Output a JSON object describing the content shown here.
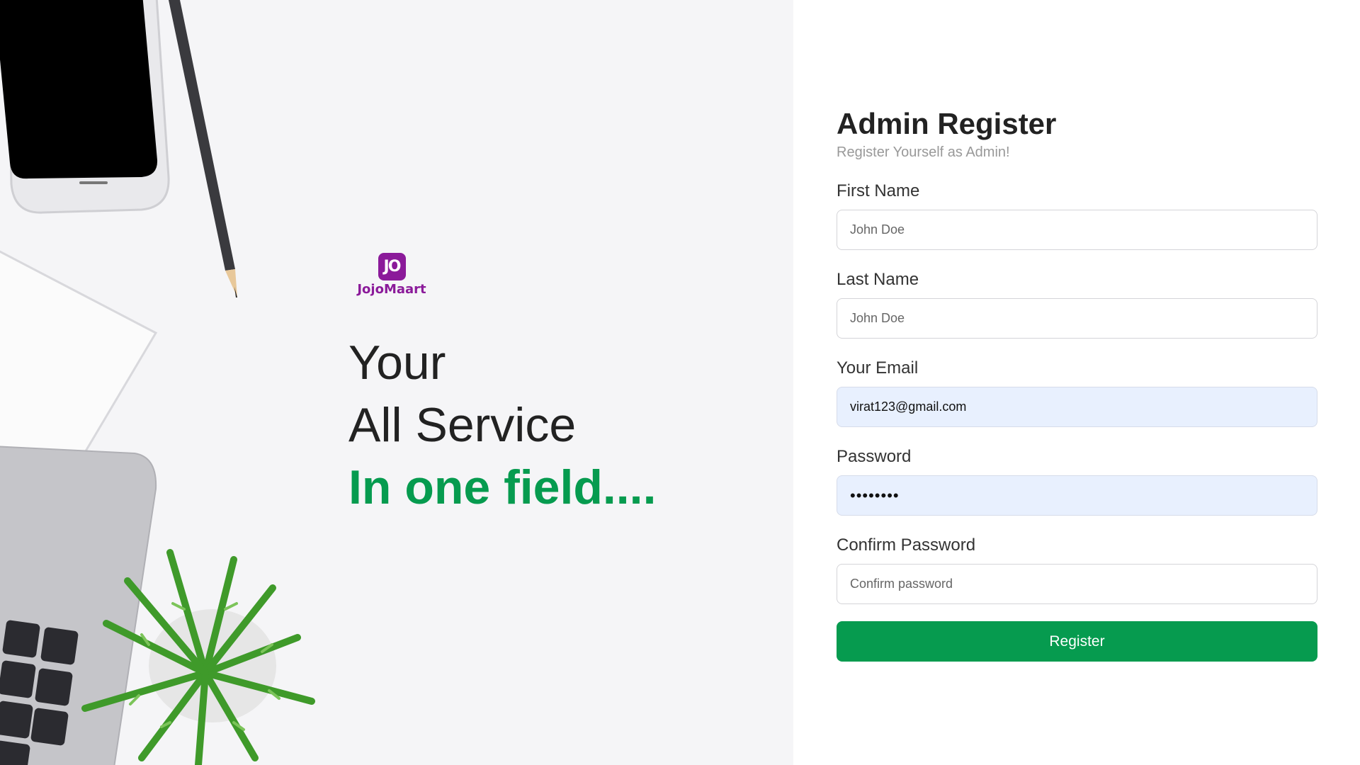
{
  "brand": {
    "badge": "JO",
    "name": "JojoMaart",
    "color": "#8b1a9a"
  },
  "hero": {
    "line1": "Your",
    "line2": "All Service",
    "line3": "In one field....",
    "accent_color": "#069b4f"
  },
  "form": {
    "title": "Admin Register",
    "subtitle": "Register Yourself as Admin!",
    "fields": [
      {
        "label": "First Name",
        "placeholder": "John Doe",
        "value": ""
      },
      {
        "label": "Last Name",
        "placeholder": "John Doe",
        "value": ""
      },
      {
        "label": "Your Email",
        "placeholder": "",
        "value": "virat123@gmail.com"
      },
      {
        "label": "Password",
        "placeholder": "",
        "value": "••••••••"
      },
      {
        "label": "Confirm Password",
        "placeholder": "Confirm password",
        "value": ""
      }
    ],
    "submit_label": "Register",
    "submit_color": "#069b4f"
  }
}
